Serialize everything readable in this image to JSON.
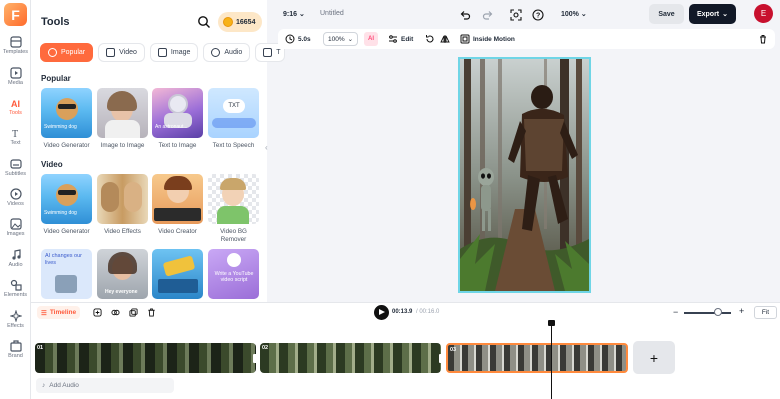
{
  "rail": {
    "items": [
      {
        "label": "Templates"
      },
      {
        "label": "Media"
      },
      {
        "label": "Tools"
      },
      {
        "label": "Text"
      },
      {
        "label": "Subtitles"
      },
      {
        "label": "Videos"
      },
      {
        "label": "Images"
      },
      {
        "label": "Audio"
      },
      {
        "label": "Elements"
      },
      {
        "label": "Effects"
      },
      {
        "label": "Brand"
      }
    ],
    "active": "Tools",
    "accent": "#ff5a3c"
  },
  "panel": {
    "title": "Tools",
    "credits": "16654",
    "tabs": [
      "Popular",
      "Video",
      "Image",
      "Audio",
      "T"
    ],
    "sections": {
      "popular": "Popular",
      "video": "Video"
    },
    "popular_cards": [
      {
        "caption": "Video Generator",
        "thumb_tag": "Swimming dog"
      },
      {
        "caption": "Image to Image",
        "thumb_tag": ""
      },
      {
        "caption": "Text to Image",
        "thumb_tag": "An astronaut..."
      },
      {
        "caption": "Text to Speech",
        "thumb_tag": "TXT"
      }
    ],
    "video_cards": [
      {
        "caption": "Video Generator",
        "thumb_tag": "Swimming dog"
      },
      {
        "caption": "Video Effects",
        "thumb_tag": ""
      },
      {
        "caption": "Video Creator",
        "thumb_tag": ""
      },
      {
        "caption": "Video BG Remover",
        "thumb_tag": ""
      }
    ],
    "more_cards": [
      {
        "thumb_tag": "AI changes our lives"
      },
      {
        "thumb_tag": "Hey everyone"
      },
      {
        "thumb_tag": ""
      },
      {
        "thumb_tag": "Write a YouTube video script"
      }
    ]
  },
  "topbar": {
    "ratio": "9:16",
    "title": "Untitled",
    "zoom": "100%",
    "save": "Save",
    "export": "Export",
    "avatar_initial": "E"
  },
  "edit_toolbar": {
    "duration": "5.0s",
    "zoom": "100%",
    "edit": "Edit",
    "inside_motion": "Inside Motion"
  },
  "timeline": {
    "tab": "Timeline",
    "current_time": "00:13.9",
    "total_time": "/ 00:16.0",
    "fit": "Fit",
    "clips": [
      "01",
      "02",
      "03"
    ],
    "add_audio": "Add Audio",
    "add_clip": "+"
  }
}
